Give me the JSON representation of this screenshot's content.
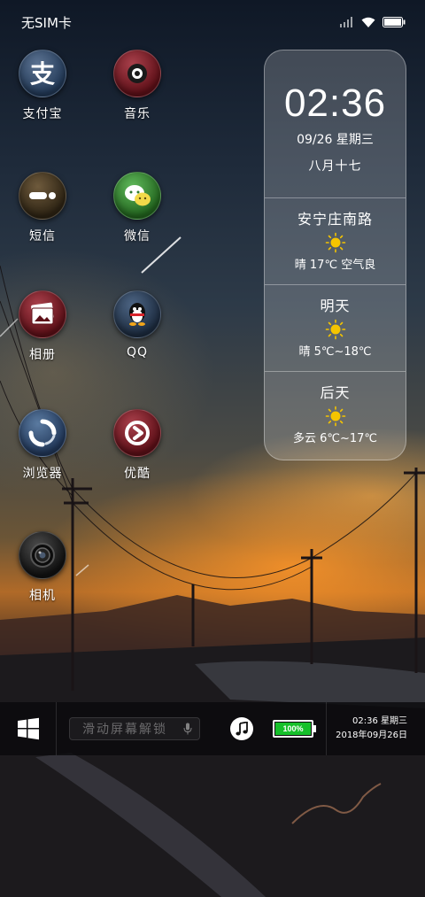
{
  "status_bar": {
    "carrier": "无SIM卡",
    "icons": [
      "signal-icon",
      "wifi-icon",
      "battery-icon"
    ]
  },
  "apps": [
    {
      "label": "支付宝",
      "icon": "alipay-icon",
      "color": "#2e4a6e"
    },
    {
      "label": "音乐",
      "icon": "music-icon",
      "color": "#7a1a24"
    },
    {
      "label": "短信",
      "icon": "sms-icon",
      "color": "#4a3820"
    },
    {
      "label": "微信",
      "icon": "wechat-icon",
      "color": "#2f7a2f"
    },
    {
      "label": "相册",
      "icon": "gallery-icon",
      "color": "#7a1a24"
    },
    {
      "label": "QQ",
      "icon": "qq-icon",
      "color": "#2a3c55"
    },
    {
      "label": "浏览器",
      "icon": "browser-icon",
      "color": "#2c4566"
    },
    {
      "label": "优酷",
      "icon": "youku-icon",
      "color": "#7a1a24"
    },
    {
      "label": "相机",
      "icon": "camera-icon",
      "color": "#222222"
    }
  ],
  "widget": {
    "time": "02:36",
    "date": "09/26 星期三",
    "lunar": "八月十七",
    "weather": [
      {
        "title": "安宁庄南路",
        "desc": "晴 17℃ 空气良",
        "icon": "sun-icon"
      },
      {
        "title": "明天",
        "desc": "晴 5℃~18℃",
        "icon": "sun-icon"
      },
      {
        "title": "后天",
        "desc": "多云 6℃~17℃",
        "icon": "sun-icon"
      }
    ]
  },
  "taskbar": {
    "start_icon": "windows-icon",
    "unlock_text": "滑动屏幕解锁",
    "unlock_icon": "microphone-icon",
    "music_icon": "music-note-icon",
    "battery_text": "100%",
    "battery_level": 1.0,
    "battery_color": "#16c02a",
    "tray_time": "02:36 星期三",
    "tray_date": "2018年09月26日"
  }
}
